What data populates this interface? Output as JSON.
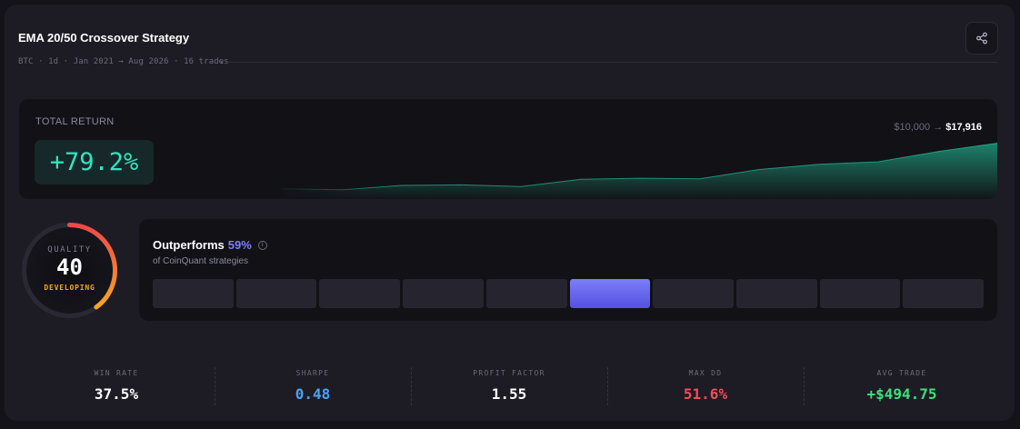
{
  "header": {
    "title": "EMA 20/50 Crossover Strategy",
    "subtitle": "BTC · 1d · Jan 2021 → Aug 2026 · 16 trades",
    "share_icon": "share-icon"
  },
  "total_return": {
    "label": "TOTAL RETURN",
    "value": "+79.2%",
    "start_value": "$10,000",
    "arrow": "→",
    "end_value": "$17,916",
    "color": "#2ee6c3",
    "equity_curve": [
      10000,
      9850,
      10600,
      10700,
      10400,
      11650,
      11850,
      11750,
      13350,
      14250,
      14700,
      16450,
      17916
    ]
  },
  "quality": {
    "label": "QUALITY",
    "score": "40",
    "level": "DEVELOPING",
    "score_fraction": 0.4,
    "colors": [
      "#ef4848",
      "#f5a623"
    ]
  },
  "outperform": {
    "headline": "Outperforms",
    "percent": "59%",
    "subtitle": "of CoinQuant strategies",
    "info_icon": "info-icon",
    "bucket_count": 10,
    "active_bucket": 5,
    "accent": "#7b80ff"
  },
  "stats": [
    {
      "label": "WIN RATE",
      "value": "37.5%",
      "color": "#ffffff"
    },
    {
      "label": "SHARPE",
      "value": "0.48",
      "color": "#4aa3f5"
    },
    {
      "label": "PROFIT FACTOR",
      "value": "1.55",
      "color": "#ffffff"
    },
    {
      "label": "MAX DD",
      "value": "51.6%",
      "color": "#f0505a"
    },
    {
      "label": "AVG TRADE",
      "value": "+$494.75",
      "color": "#3ee07a"
    }
  ]
}
